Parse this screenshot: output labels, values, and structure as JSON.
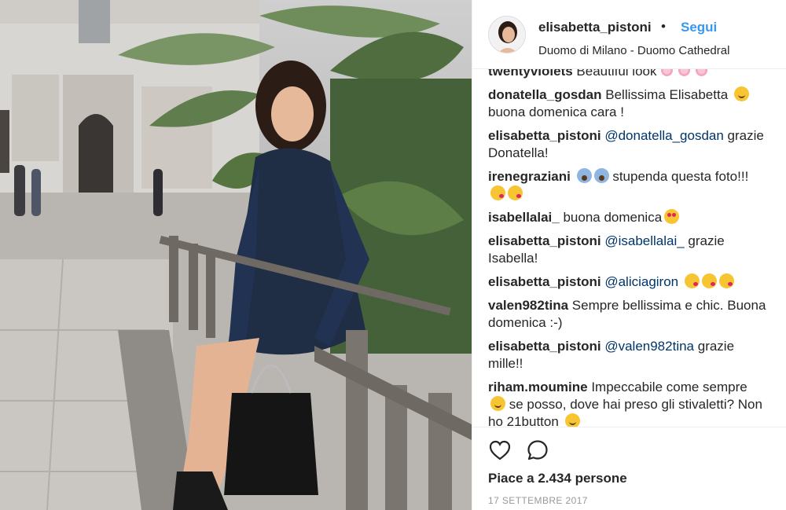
{
  "post": {
    "username": "elisabetta_pistoni",
    "separator": "•",
    "follow_label": "Segui",
    "location": "Duomo di Milano - Duomo Cathedral"
  },
  "comments": [
    {
      "author": "twentyviolets",
      "parts": [
        {
          "t": "text",
          "v": " Beautiful look"
        }
      ],
      "emoji": [
        "flower",
        "flower",
        "flower"
      ]
    },
    {
      "author": "donatella_gosdan",
      "parts": [
        {
          "t": "text",
          "v": " Bellissima Elisabetta "
        }
      ],
      "emoji_inline": [
        "smile"
      ],
      "tail": " buona domenica cara !"
    },
    {
      "author": "elisabetta_pistoni",
      "parts": [
        {
          "t": "mention",
          "v": " @donatella_gosdan"
        },
        {
          "t": "text",
          "v": " grazie Donatella!"
        }
      ]
    },
    {
      "author": "irenegraziani",
      "parts": [
        {
          "t": "text",
          "v": " "
        }
      ],
      "emoji_inline": [
        "scream",
        "scream"
      ],
      "tail": "  stupenda questa foto!!! ",
      "emoji_tail": [
        "kiss",
        "kiss"
      ]
    },
    {
      "author": "isabellalai_",
      "parts": [
        {
          "t": "text",
          "v": " buona domenica"
        }
      ],
      "emoji": [
        "heart-eyes"
      ]
    },
    {
      "author": "elisabetta_pistoni",
      "parts": [
        {
          "t": "mention",
          "v": " @isabellalai_"
        },
        {
          "t": "text",
          "v": "  grazie Isabella!"
        }
      ]
    },
    {
      "author": "elisabetta_pistoni",
      "parts": [
        {
          "t": "mention",
          "v": " @aliciagiron"
        },
        {
          "t": "text",
          "v": " "
        }
      ],
      "emoji": [
        "kiss",
        "kiss",
        "kiss"
      ]
    },
    {
      "author": "valen982tina",
      "parts": [
        {
          "t": "text",
          "v": " Sempre bellissima e chic. Buona domenica :-)"
        }
      ]
    },
    {
      "author": "elisabetta_pistoni",
      "parts": [
        {
          "t": "mention",
          "v": " @valen982tina"
        },
        {
          "t": "text",
          "v": " grazie mille!!"
        }
      ]
    },
    {
      "author": "riham.moumine",
      "parts": [
        {
          "t": "text",
          "v": " Impeccabile come sempre "
        }
      ],
      "emoji_inline": [
        "smile"
      ],
      "tail": " se posso, dove hai preso gli stivaletti? Non ho 21button ",
      "emoji_tail": [
        "relieved"
      ]
    }
  ],
  "actions": {
    "like_icon": "heart-icon",
    "comment_icon": "comment-bubble-icon",
    "likes_text": "Piace a 2.434 persone",
    "date_text": "17 SETTEMBRE 2017"
  },
  "colors": {
    "link": "#3897f0",
    "mention": "#003569",
    "text": "#262626",
    "muted": "#999999"
  }
}
